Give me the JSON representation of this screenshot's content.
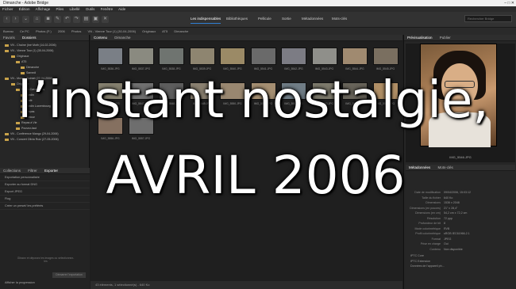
{
  "window": {
    "title": "Dimanche - Adobe Bridge",
    "controls": "–  □  ✕"
  },
  "menu": [
    "Fichier",
    "Édition",
    "Affichage",
    "Piles",
    "Libellé",
    "Outils",
    "Fenêtre",
    "Aide"
  ],
  "workspaces": [
    "Les indispensables",
    "Bibliothèques",
    "Pellicule",
    "Sortie",
    "Métadonnées",
    "Mots-clés"
  ],
  "search_placeholder": "Rechercher Bridge",
  "path": [
    "Bureau",
    "Ce PC",
    "Photos (F:)",
    "2006",
    "Photos",
    "VN - Vienne Tour (1) (30-04-2006)",
    "Originaux",
    "AT5",
    "Dimanche"
  ],
  "left_tabs": [
    "Favoris",
    "Dossiers"
  ],
  "tree": [
    "VN - Chaîne (Iné Moth (14-02-2006)",
    "VN - Vienne Tour (1) (30-04-2006)",
    "Originaux",
    "AT5",
    "Dimanche",
    "Samedi",
    "VN - Musée Guimet (22-04-2006)",
    "Originaux",
    "Sacré-Cœur Paris",
    "Jardin",
    "Café",
    "Jardin Luxembourg",
    "Repas",
    "Retour",
    "Repas à Vie",
    "Pouvez-faut",
    "VN - Conférence Mango (29-04-2006)",
    "VN - Concert Olivia Ruiz (27-05-2006)"
  ],
  "content_tabs": [
    "Contenu",
    "Dimanche"
  ],
  "thumbs": [
    {
      "label": "IMG_5536.JPG",
      "tone": "#7a7f86"
    },
    {
      "label": "IMG_5537.JPG",
      "tone": "#8a8a80"
    },
    {
      "label": "IMG_5538.JPG",
      "tone": "#6f7470"
    },
    {
      "label": "IMG_5539.JPG",
      "tone": "#8e8570"
    },
    {
      "label": "IMG_5540.JPG",
      "tone": "#9b8a66"
    },
    {
      "label": "IMG_5541.JPG",
      "tone": "#6a6a6a"
    },
    {
      "label": "IMG_5542.JPG",
      "tone": "#7c7c84"
    },
    {
      "label": "IMG_5543.JPG",
      "tone": "#8f8f8a"
    },
    {
      "label": "IMG_5544.JPG",
      "tone": "#a08a70"
    },
    {
      "label": "IMG_5545.JPG",
      "tone": "#7a6f60"
    },
    {
      "label": "IMG_5546.JPG",
      "tone": "#85806f"
    },
    {
      "label": "IMG_5547.JPG",
      "tone": "#707070"
    },
    {
      "label": "IMG_5548.JPG",
      "tone": "#5d5d5d"
    },
    {
      "label": "IMG_5549.JPG",
      "tone": "#8a8070"
    },
    {
      "label": "IMG_5550.JPG",
      "tone": "#998770"
    },
    {
      "label": "IMG_5551.JPG",
      "tone": "#a58f72"
    },
    {
      "label": "IMG_5552.JPG",
      "tone": "#707d86"
    },
    {
      "label": "IMG_5553.JPG",
      "tone": "#7d7a6c"
    },
    {
      "label": "IMG_5554.JPG",
      "tone": "#68645a"
    },
    {
      "label": "IMG_5555.JPG",
      "tone": "#b08f66"
    },
    {
      "label": "IMG_5556.JPG",
      "tone": "#857060"
    },
    {
      "label": "IMG_5557.JPG",
      "tone": "#6e6e6e"
    }
  ],
  "bottom_left_tabs": [
    "Collections",
    "Filtrer",
    "Exporter"
  ],
  "export_items": [
    "Exportation personnalisée",
    "Exporter au format DNG",
    "Export JPEG",
    "Flog",
    "Créer un preset/ les préférés"
  ],
  "export_note": "Glissez et déposez les images ou sélectionnez-les",
  "export_button": "Démarrer l'exportation",
  "export_footer": "Afficher la progression",
  "status": "43 éléments, 1 sélectionné(s) - 640 Ko",
  "right_tabs": [
    "Prévisualisation",
    "Publier"
  ],
  "preview_label": "IMG_5546.JPG",
  "meta_tabs": [
    "Métadonnées",
    "Mots-clés"
  ],
  "metadata": [
    {
      "k": "Date de modification",
      "v": "09/04/2006, 15:03:12"
    },
    {
      "k": "Taille du fichier",
      "v": "640 Ko"
    },
    {
      "k": "Dimensions",
      "v": "1536 x 2048"
    },
    {
      "k": "Dimensions (en pouces)",
      "v": "21\" x 28,4\""
    },
    {
      "k": "Dimensions (en cm)",
      "v": "54,2 cm x 72,2 cm"
    },
    {
      "k": "Résolution",
      "v": "72 ppp"
    },
    {
      "k": "Profondeur de bit",
      "v": "8"
    },
    {
      "k": "Mode colorimétrique",
      "v": "RVB"
    },
    {
      "k": "Profil colorimétrique",
      "v": "sRGB IEC61966-2.1"
    },
    {
      "k": "Format",
      "v": "JPEG"
    },
    {
      "k": "Prise en charge",
      "v": "Oui"
    },
    {
      "k": "Contenu",
      "v": "Non disponible"
    }
  ],
  "meta_sections": [
    "IPTC Core",
    "IPTC Extension",
    "Données de l'appareil ph..."
  ],
  "overlay": {
    "line1": "l’instant nostalgie,",
    "line2": "AVRIL 2006"
  }
}
